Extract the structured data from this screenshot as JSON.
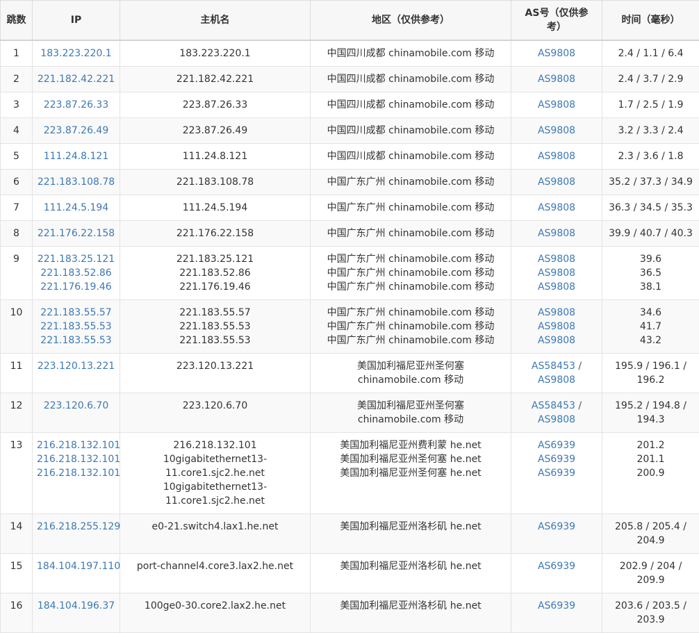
{
  "headers": {
    "hop": "跳数",
    "ip": "IP",
    "host": "主机名",
    "region": "地区（仅供参考）",
    "as": "AS号（仅供参考）",
    "time": "时间（毫秒）"
  },
  "rows": [
    {
      "hop": "1",
      "ip": [
        "183.223.220.1"
      ],
      "host": [
        "183.223.220.1"
      ],
      "region": [
        "中国四川成都 chinamobile.com 移动"
      ],
      "as": [
        "AS9808"
      ],
      "time": [
        "2.4 / 1.1 / 6.4"
      ]
    },
    {
      "hop": "2",
      "ip": [
        "221.182.42.221"
      ],
      "host": [
        "221.182.42.221"
      ],
      "region": [
        "中国四川成都 chinamobile.com 移动"
      ],
      "as": [
        "AS9808"
      ],
      "time": [
        "2.4 / 3.7 / 2.9"
      ]
    },
    {
      "hop": "3",
      "ip": [
        "223.87.26.33"
      ],
      "host": [
        "223.87.26.33"
      ],
      "region": [
        "中国四川成都 chinamobile.com 移动"
      ],
      "as": [
        "AS9808"
      ],
      "time": [
        "1.7 / 2.5 / 1.9"
      ]
    },
    {
      "hop": "4",
      "ip": [
        "223.87.26.49"
      ],
      "host": [
        "223.87.26.49"
      ],
      "region": [
        "中国四川成都 chinamobile.com 移动"
      ],
      "as": [
        "AS9808"
      ],
      "time": [
        "3.2 / 3.3 / 2.4"
      ]
    },
    {
      "hop": "5",
      "ip": [
        "111.24.8.121"
      ],
      "host": [
        "111.24.8.121"
      ],
      "region": [
        "中国四川成都 chinamobile.com 移动"
      ],
      "as": [
        "AS9808"
      ],
      "time": [
        "2.3 / 3.6 / 1.8"
      ]
    },
    {
      "hop": "6",
      "ip": [
        "221.183.108.78"
      ],
      "host": [
        "221.183.108.78"
      ],
      "region": [
        "中国广东广州 chinamobile.com 移动"
      ],
      "as": [
        "AS9808"
      ],
      "time": [
        "35.2 / 37.3 / 34.9"
      ]
    },
    {
      "hop": "7",
      "ip": [
        "111.24.5.194"
      ],
      "host": [
        "111.24.5.194"
      ],
      "region": [
        "中国广东广州 chinamobile.com 移动"
      ],
      "as": [
        "AS9808"
      ],
      "time": [
        "36.3 / 34.5 / 35.3"
      ]
    },
    {
      "hop": "8",
      "ip": [
        "221.176.22.158"
      ],
      "host": [
        "221.176.22.158"
      ],
      "region": [
        "中国广东广州 chinamobile.com 移动"
      ],
      "as": [
        "AS9808"
      ],
      "time": [
        "39.9 / 40.7 / 40.3"
      ]
    },
    {
      "hop": "9",
      "ip": [
        "221.183.25.121",
        "221.183.52.86",
        "221.176.19.46"
      ],
      "host": [
        "221.183.25.121",
        "221.183.52.86",
        "221.176.19.46"
      ],
      "region": [
        "中国广东广州 chinamobile.com 移动",
        "中国广东广州 chinamobile.com 移动",
        "中国广东广州 chinamobile.com 移动"
      ],
      "as": [
        "AS9808",
        "AS9808",
        "AS9808"
      ],
      "time": [
        "39.6",
        "36.5",
        "38.1"
      ]
    },
    {
      "hop": "10",
      "ip": [
        "221.183.55.57",
        "221.183.55.53",
        "221.183.55.53"
      ],
      "host": [
        "221.183.55.57",
        "221.183.55.53",
        "221.183.55.53"
      ],
      "region": [
        "中国广东广州 chinamobile.com 移动",
        "中国广东广州 chinamobile.com 移动",
        "中国广东广州 chinamobile.com 移动"
      ],
      "as": [
        "AS9808",
        "AS9808",
        "AS9808"
      ],
      "time": [
        "34.6",
        "41.7",
        "43.2"
      ]
    },
    {
      "hop": "11",
      "ip": [
        "223.120.13.221"
      ],
      "host": [
        "223.120.13.221"
      ],
      "region": [
        "美国加利福尼亚州圣何塞",
        "chinamobile.com 移动"
      ],
      "as": [
        "AS58453 /",
        "AS9808"
      ],
      "time": [
        "195.9 / 196.1 /",
        "196.2"
      ]
    },
    {
      "hop": "12",
      "ip": [
        "223.120.6.70"
      ],
      "host": [
        "223.120.6.70"
      ],
      "region": [
        "美国加利福尼亚州圣何塞",
        "chinamobile.com 移动"
      ],
      "as": [
        "AS58453 /",
        "AS9808"
      ],
      "time": [
        "195.2 / 194.8 /",
        "194.3"
      ]
    },
    {
      "hop": "13",
      "ip": [
        "216.218.132.101",
        "216.218.132.101",
        "216.218.132.101"
      ],
      "host": [
        "216.218.132.101",
        "10gigabitethernet13-",
        "11.core1.sjc2.he.net",
        "10gigabitethernet13-",
        "11.core1.sjc2.he.net"
      ],
      "region": [
        "美国加利福尼亚州费利蒙 he.net",
        "美国加利福尼亚州圣何塞 he.net",
        "美国加利福尼亚州圣何塞 he.net"
      ],
      "as": [
        "AS6939",
        "AS6939",
        "AS6939"
      ],
      "time": [
        "201.2",
        "201.1",
        "200.9"
      ]
    },
    {
      "hop": "14",
      "ip": [
        "216.218.255.129"
      ],
      "host": [
        "e0-21.switch4.lax1.he.net"
      ],
      "region": [
        "美国加利福尼亚州洛杉矶 he.net"
      ],
      "as": [
        "AS6939"
      ],
      "time": [
        "205.8 / 205.4 /",
        "204.9"
      ]
    },
    {
      "hop": "15",
      "ip": [
        "184.104.197.110"
      ],
      "host": [
        "port-channel4.core3.lax2.he.net"
      ],
      "region": [
        "美国加利福尼亚州洛杉矶 he.net"
      ],
      "as": [
        "AS6939"
      ],
      "time": [
        "202.9 / 204 /",
        "209.9"
      ]
    },
    {
      "hop": "16",
      "ip": [
        "184.104.196.37"
      ],
      "host": [
        "100ge0-30.core2.lax2.he.net"
      ],
      "region": [
        "美国加利福尼亚州洛杉矶 he.net"
      ],
      "as": [
        "AS6939"
      ],
      "time": [
        "203.6 / 203.5 /",
        "203.9"
      ]
    }
  ]
}
